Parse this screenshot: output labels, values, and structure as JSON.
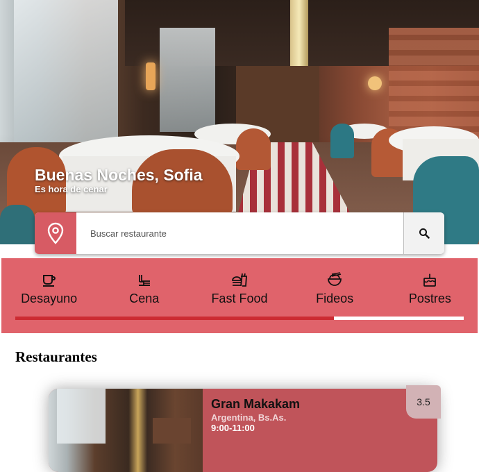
{
  "header": {
    "greeting": "Buenas Noches, Sofia",
    "subtitle": "Es hora de cenar"
  },
  "search": {
    "placeholder": "Buscar restaurante",
    "icon": "location-pin-icon",
    "button_icon": "search-icon"
  },
  "categories": [
    {
      "label": "Desayuno",
      "icon": "coffee-cup-icon"
    },
    {
      "label": "Cena",
      "icon": "dinner-icon"
    },
    {
      "label": "Fast Food",
      "icon": "fast-food-icon"
    },
    {
      "label": "Fideos",
      "icon": "noodles-bowl-icon"
    },
    {
      "label": "Postres",
      "icon": "cake-icon"
    }
  ],
  "scroll_progress": 0.71,
  "colors": {
    "accent": "#e0636b",
    "accent_dark": "#cc2b32",
    "pin_bg": "#d75b64",
    "card_bg": "#c0545a"
  },
  "section_title": "Restaurantes",
  "restaurants": [
    {
      "name": "Gran Makakam",
      "location": "Argentina, Bs.As.",
      "hours": "9:00-11:00",
      "rating": "3.5"
    }
  ]
}
